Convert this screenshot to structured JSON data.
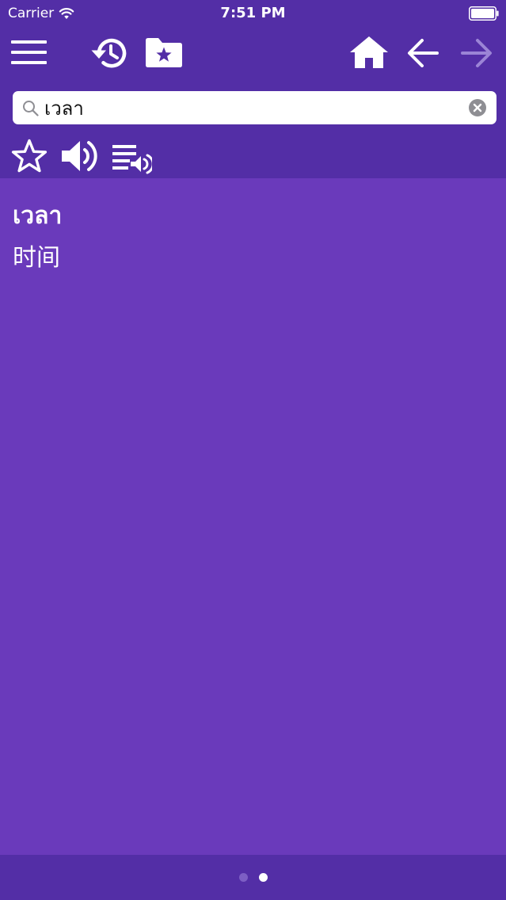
{
  "status_bar": {
    "carrier": "Carrier",
    "time": "7:51 PM"
  },
  "toolbar": {
    "icons": [
      "menu-icon",
      "history-icon",
      "favorites-folder-icon",
      "home-icon",
      "back-arrow-icon",
      "forward-arrow-icon"
    ],
    "forward_enabled": false
  },
  "search": {
    "value": "เวลา",
    "placeholder": ""
  },
  "actions": {
    "icons": [
      "star-icon",
      "speaker-icon",
      "playlist-audio-icon"
    ]
  },
  "entry": {
    "word": "เวลา",
    "translation": "时间"
  },
  "page_control": {
    "pages": 2,
    "current": 2
  },
  "colors": {
    "header": "#532ea6",
    "content": "#6a3abb",
    "text": "#ffffff",
    "disabled_icon": "#9b84d6"
  }
}
